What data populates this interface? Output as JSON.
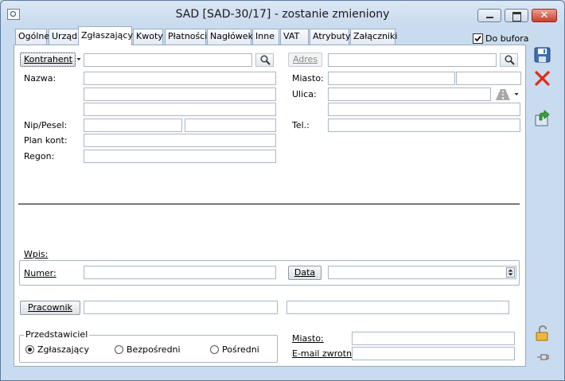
{
  "window": {
    "title": "SAD [SAD-30/17]  - zostanie zmieniony",
    "minimize_glyph": "▁",
    "maximize_glyph": "▢",
    "close_glyph": "✕"
  },
  "tabs": [
    {
      "label": "Ogólne"
    },
    {
      "label": "Urząd"
    },
    {
      "label": "Zgłaszający",
      "active": true
    },
    {
      "label": "Kwoty"
    },
    {
      "label": "Płatności"
    },
    {
      "label": "Nagłówek"
    },
    {
      "label": "Inne"
    },
    {
      "label": "VAT"
    },
    {
      "label": "Atrybuty"
    },
    {
      "label": "Załączniki"
    }
  ],
  "do_bufora": {
    "label": "Do bufora",
    "checked": true
  },
  "kontrahent": {
    "button_label": "Kontrahent",
    "code_value": ""
  },
  "adres": {
    "button_label": "Adres",
    "value": ""
  },
  "fields_left": {
    "nazwa": "Nazwa:",
    "nip": "Nip/Pesel:",
    "plan_kont": "Plan kont:",
    "regon": "Regon:"
  },
  "fields_right": {
    "miasto": "Miasto:",
    "ulica": "Ulica:",
    "tel": "Tel.:"
  },
  "wpis": {
    "group_label": "Wpis:",
    "numer_label": "Numer:",
    "numer_value": "",
    "data_button": "Data",
    "data_value": ""
  },
  "pracownik": {
    "button_label": "Pracownik",
    "value1": "",
    "value2": ""
  },
  "przedstawiciel": {
    "group_label": "Przedstawiciel",
    "options": [
      {
        "label": "Zgłaszający",
        "selected": true
      },
      {
        "label": "Bezpośredni",
        "selected": false
      },
      {
        "label": "Pośredni",
        "selected": false
      }
    ]
  },
  "bottom_right": {
    "miasto_label": "Miasto:",
    "email_label": "E-mail zwrotny:"
  },
  "icons": {
    "search": "magnifier-icon",
    "save": "floppy-save-icon",
    "cancel": "red-x-icon",
    "export": "green-arrow-export-icon",
    "lock": "padlock-icon",
    "pin": "pushpin-icon",
    "road": "road-icon"
  },
  "colors": {
    "title_bg": "#c9dbee",
    "close_red": "#c8402a",
    "cancel_red": "#e02a1a",
    "save_blue": "#3c6fb8"
  }
}
